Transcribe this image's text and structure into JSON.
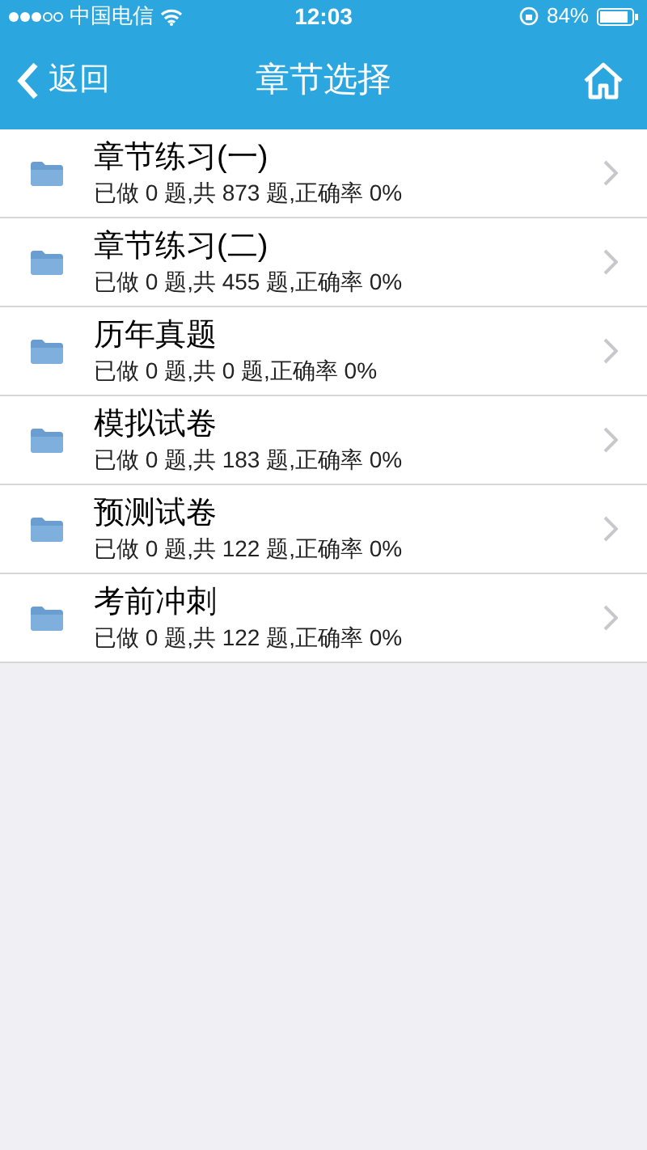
{
  "status_bar": {
    "carrier": "中国电信",
    "time": "12:03",
    "battery": "84%"
  },
  "nav_bar": {
    "back": "返回",
    "title": "章节选择"
  },
  "items": [
    {
      "title": "章节练习(一)",
      "subtitle": "已做 0 题,共 873 题,正确率 0%"
    },
    {
      "title": "章节练习(二)",
      "subtitle": "已做 0 题,共 455 题,正确率 0%"
    },
    {
      "title": "历年真题",
      "subtitle": "已做 0 题,共 0 题,正确率 0%"
    },
    {
      "title": "模拟试卷",
      "subtitle": "已做 0 题,共 183 题,正确率 0%"
    },
    {
      "title": "预测试卷",
      "subtitle": "已做 0 题,共 122 题,正确率 0%"
    },
    {
      "title": "考前冲刺",
      "subtitle": "已做 0 题,共 122 题,正确率 0%"
    }
  ]
}
